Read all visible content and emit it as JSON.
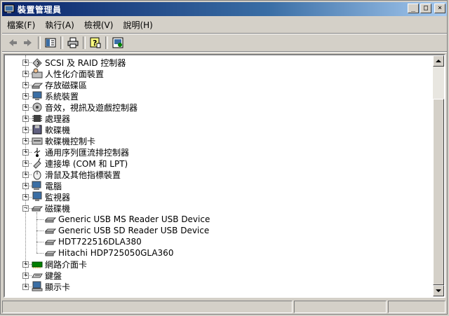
{
  "window": {
    "title": "裝置管理員",
    "controls": {
      "minimize": "_",
      "maximize": "□",
      "close": "×"
    }
  },
  "menubar": {
    "items": [
      {
        "label": "檔案(F)",
        "accel": "F"
      },
      {
        "label": "執行(A)",
        "accel": "A"
      },
      {
        "label": "檢視(V)",
        "accel": "V"
      },
      {
        "label": "說明(H)",
        "accel": "H"
      }
    ]
  },
  "toolbar": {
    "items": [
      "back-icon",
      "forward-icon",
      "properties-panel-icon",
      "print-icon",
      "help-icon",
      "scan-hardware-icon"
    ]
  },
  "tree": {
    "nodes": [
      {
        "label": "SCSI 及 RAID 控制器",
        "icon": "scsi-icon",
        "expanded": false
      },
      {
        "label": "人性化介面裝置",
        "icon": "hid-icon",
        "expanded": false
      },
      {
        "label": "存放磁碟區",
        "icon": "volume-icon",
        "expanded": false
      },
      {
        "label": "系統裝置",
        "icon": "system-device-icon",
        "expanded": false
      },
      {
        "label": "音效，視訊及遊戲控制器",
        "icon": "audio-icon",
        "expanded": false
      },
      {
        "label": "處理器",
        "icon": "cpu-icon",
        "expanded": false
      },
      {
        "label": "軟碟機",
        "icon": "floppy-drive-icon",
        "expanded": false
      },
      {
        "label": "軟碟機控制卡",
        "icon": "floppy-controller-icon",
        "expanded": false
      },
      {
        "label": "通用序列匯流排控制器",
        "icon": "usb-icon",
        "expanded": false
      },
      {
        "label": "連接埠 (COM 和 LPT)",
        "icon": "port-icon",
        "expanded": false
      },
      {
        "label": "滑鼠及其他指標裝置",
        "icon": "mouse-icon",
        "expanded": false
      },
      {
        "label": "電腦",
        "icon": "computer-icon",
        "expanded": false
      },
      {
        "label": "監視器",
        "icon": "monitor-icon",
        "expanded": false
      },
      {
        "label": "磁碟機",
        "icon": "disk-drive-icon",
        "expanded": true,
        "children": [
          {
            "label": "Generic USB MS Reader USB Device",
            "icon": "disk-icon"
          },
          {
            "label": "Generic USB SD Reader USB Device",
            "icon": "disk-icon"
          },
          {
            "label": "HDT722516DLA380",
            "icon": "disk-icon"
          },
          {
            "label": "Hitachi HDP725050GLA360",
            "icon": "disk-icon"
          }
        ]
      },
      {
        "label": "網路介面卡",
        "icon": "network-adapter-icon",
        "expanded": false
      },
      {
        "label": "鍵盤",
        "icon": "keyboard-icon",
        "expanded": false
      },
      {
        "label": "顯示卡",
        "icon": "display-adapter-icon",
        "expanded": false
      }
    ]
  },
  "expander": {
    "collapsed": "+",
    "expanded": "−"
  },
  "statusbar": {
    "panes": [
      "",
      "",
      ""
    ]
  },
  "colors": {
    "title_start": "#0a246a",
    "title_end": "#a6caf0",
    "face": "#d4d0c8"
  }
}
